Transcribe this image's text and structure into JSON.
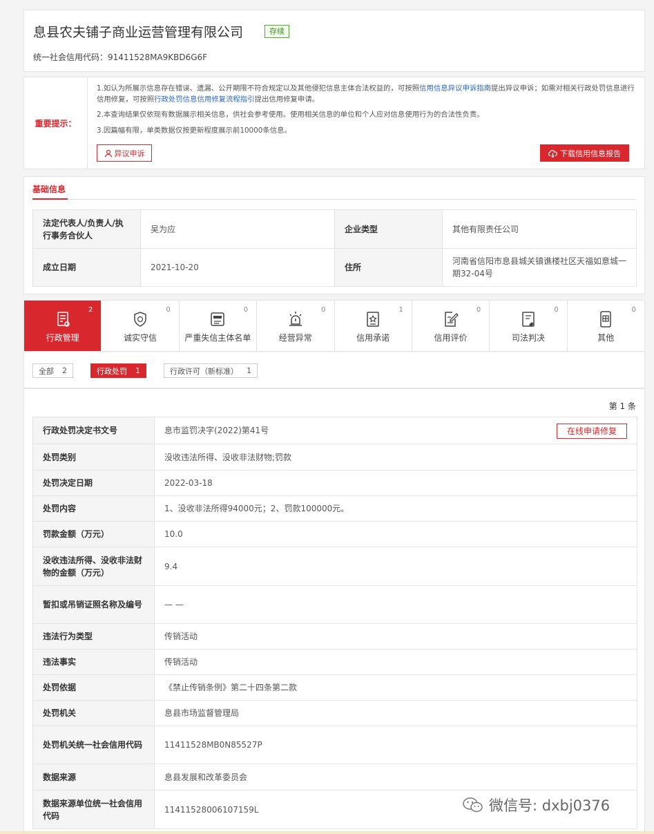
{
  "company": {
    "name": "息县农夫铺子商业运营管理有限公司",
    "status": "存续",
    "credit_code_label": "统一社会信用代码：91411528MA9KBD6G6F"
  },
  "notice": {
    "label": "重要提示：",
    "line1_a": "1.如认为所展示信息存在错误、遗漏、公开期限不符合规定以及其他侵犯信息主体合法权益的，可按照",
    "line1_link1": "信用信息异议申诉指南",
    "line1_b": "提出异议申诉；如需对相关行政处罚信息进行信用修复，可按照",
    "line1_link2": "行政处罚信息信用修复流程指引",
    "line1_c": "提出信用修复申请。",
    "line2": "2.本查询结果仅依现有数据展示相关信息，供社会参考使用。使用相关信息的单位和个人应对信息使用行为的合法性负责。",
    "line3": "3.因篇幅有限，单类数据仅按更新程度展示前10000条信息。",
    "objection_btn": "异议申诉",
    "download_btn": "下载信用信息报告"
  },
  "basic": {
    "title": "基础信息",
    "rows": [
      {
        "k1": "法定代表人/负责人/执行事务合伙人",
        "v1": "吴为应",
        "k2": "企业类型",
        "v2": "其他有限责任公司"
      },
      {
        "k1": "成立日期",
        "v1": "2021-10-20",
        "k2": "住所",
        "v2": "河南省信阳市息县城关镇谯楼社区天福如意城一期32-04号"
      }
    ]
  },
  "tabs": [
    {
      "label": "行政管理",
      "count": "2",
      "icon": "admin-icon"
    },
    {
      "label": "诚实守信",
      "count": "0",
      "icon": "shield-icon"
    },
    {
      "label": "严重失信主体名单",
      "count": "0",
      "icon": "blacklist-icon"
    },
    {
      "label": "经营异常",
      "count": "0",
      "icon": "alarm-icon"
    },
    {
      "label": "信用承诺",
      "count": "1",
      "icon": "promise-icon"
    },
    {
      "label": "信用评价",
      "count": "0",
      "icon": "evaluate-icon"
    },
    {
      "label": "司法判决",
      "count": "0",
      "icon": "judgement-icon"
    },
    {
      "label": "其他",
      "count": "0",
      "icon": "other-icon"
    }
  ],
  "filters": [
    {
      "label": "全部",
      "count": "2"
    },
    {
      "label": "行政处罚",
      "count": "1"
    },
    {
      "label": "行政许可（新标准）",
      "count": "1"
    }
  ],
  "detail": {
    "page_label": "第 1 条",
    "fix_btn": "在线申请修复",
    "rows": [
      {
        "k": "行政处罚决定书文号",
        "v": "息市监罚决字(2022)第41号"
      },
      {
        "k": "处罚类别",
        "v": "没收违法所得、没收非法财物;罚款"
      },
      {
        "k": "处罚决定日期",
        "v": "2022-03-18"
      },
      {
        "k": "处罚内容",
        "v": "1、没收非法所得94000元；2、罚款100000元。"
      },
      {
        "k": "罚款金额（万元）",
        "v": "10.0"
      },
      {
        "k": "没收违法所得、没收非法财物的金额（万元）",
        "v": "9.4"
      },
      {
        "k": "暂扣或吊销证照名称及编号",
        "v": "— —"
      },
      {
        "k": "违法行为类型",
        "v": "传销活动"
      },
      {
        "k": "违法事实",
        "v": "传销活动"
      },
      {
        "k": "处罚依据",
        "v": "《禁止传销条例》第二十四条第二款"
      },
      {
        "k": "处罚机关",
        "v": "息县市场监督管理局"
      },
      {
        "k": "处罚机关统一社会信用代码",
        "v": "11411528MB0N85527P"
      },
      {
        "k": "数据来源",
        "v": "息县发展和改革委员会"
      },
      {
        "k": "数据来源单位统一社会信用代码",
        "v": "11411528006107159L"
      }
    ]
  },
  "watermark": "微信号: dxbj0376",
  "colors": {
    "accent": "#d9272e",
    "status_green": "#52a435",
    "link": "#2c67c4"
  }
}
